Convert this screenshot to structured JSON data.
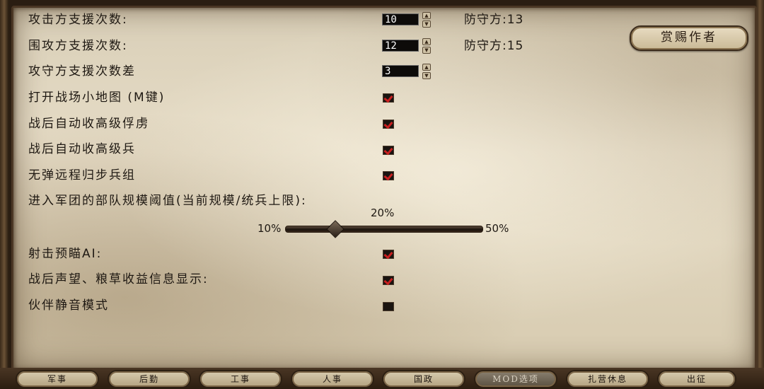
{
  "settings": {
    "attacker_support": {
      "label": "攻击方支援次数:",
      "value": "10",
      "defender": "防守方:13"
    },
    "siege_support": {
      "label": "围攻方支援次数:",
      "value": "12",
      "defender": "防守方:15"
    },
    "support_diff": {
      "label": "攻守方支援次数差",
      "value": "3"
    },
    "minimap": {
      "label": "打开战场小地图 (M键)",
      "checked": true
    },
    "auto_prisoners": {
      "label": "战后自动收高级俘虏",
      "checked": true
    },
    "auto_troops": {
      "label": "战后自动收高级兵",
      "checked": true
    },
    "ranged_to_infantry": {
      "label": "无弹远程归步兵组",
      "checked": true
    },
    "army_threshold": {
      "label": "进入军团的部队规模阈值(当前规模/统兵上限):",
      "value_label": "20%",
      "value_fraction": 0.2,
      "min_label": "10%",
      "max_label": "50%"
    },
    "aim_ai": {
      "label": "射击预瞄AI:",
      "checked": true
    },
    "reputation_info": {
      "label": "战后声望、粮草收益信息显示:",
      "checked": true
    },
    "companion_mute": {
      "label": "伙伴静音模式",
      "checked": false
    }
  },
  "reward_button": "赏赐作者",
  "tabs": [
    "军事",
    "后勤",
    "工事",
    "人事",
    "国政",
    "MOD选项",
    "扎营休息",
    "出征"
  ],
  "active_tab": "MOD选项"
}
